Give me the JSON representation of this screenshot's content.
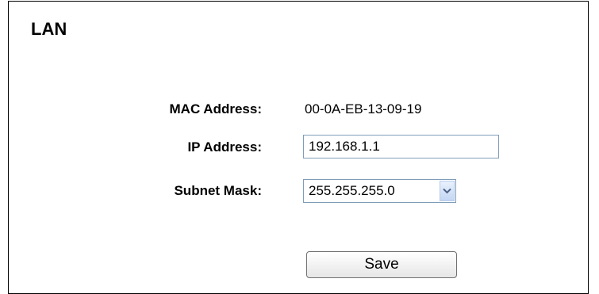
{
  "section": {
    "title": "LAN"
  },
  "fields": {
    "mac": {
      "label": "MAC Address:",
      "value": "00-0A-EB-13-09-19"
    },
    "ip": {
      "label": "IP Address:",
      "value": "192.168.1.1"
    },
    "subnet": {
      "label": "Subnet Mask:",
      "selected": "255.255.255.0"
    }
  },
  "actions": {
    "save_label": "Save"
  },
  "icons": {
    "dropdown": "chevron-down-icon"
  },
  "colors": {
    "dropdown_arrow": "#4d6185",
    "input_border": "#7f9db9"
  }
}
